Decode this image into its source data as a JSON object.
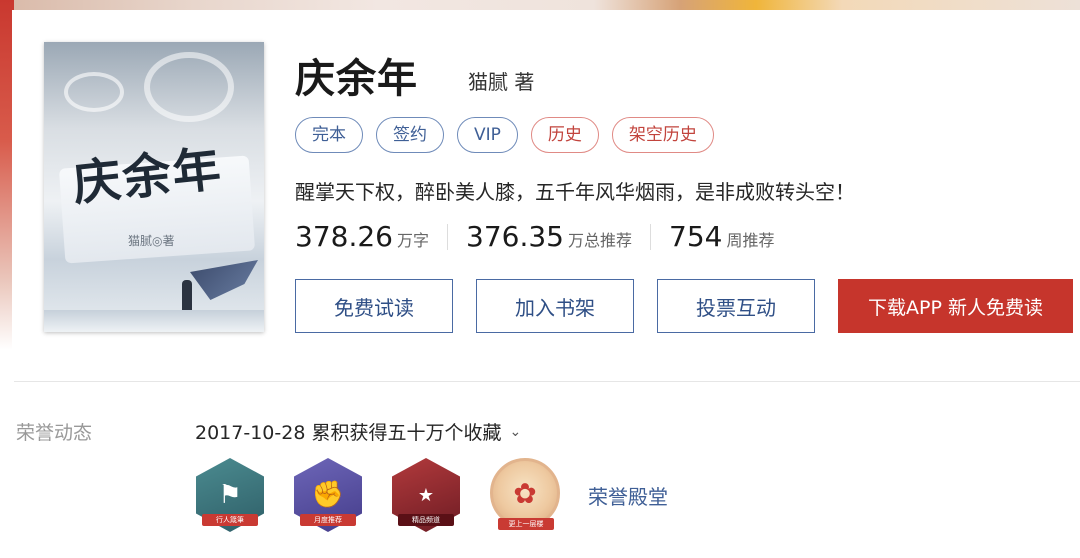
{
  "book": {
    "title": "庆余年",
    "author": "猫腻 著",
    "tags": [
      "完本",
      "签约",
      "VIP",
      "历史",
      "架空历史"
    ],
    "intro": "醒掌天下权，醉卧美人膝，五千年风华烟雨，是非成败转头空！",
    "stats": [
      {
        "num": "378.26",
        "unit": "万字"
      },
      {
        "num": "376.35",
        "unit": "万总推荐"
      },
      {
        "num": "754",
        "unit": "周推荐"
      }
    ],
    "cover": {
      "title": "庆余年",
      "author": "猫腻◎著"
    }
  },
  "actions": {
    "read": "免费试读",
    "shelf": "加入书架",
    "vote": "投票互动",
    "app": "下载APP 新人免费读"
  },
  "honor": {
    "label": "荣誉动态",
    "latest": "2017-10-28 累积获得五十万个收藏",
    "badges": [
      {
        "name": "行人箴筆",
        "icon": "map-flag-icon"
      },
      {
        "name": "月度推荐",
        "icon": "fist-icon"
      },
      {
        "name": "精品频道",
        "icon": "seal-icon"
      },
      {
        "name": "更上一层楼",
        "icon": "firecracker-icon"
      }
    ],
    "hall": "荣誉殿堂"
  },
  "colors": {
    "accent_blue": "#3f5f96",
    "accent_red": "#c6352c"
  }
}
